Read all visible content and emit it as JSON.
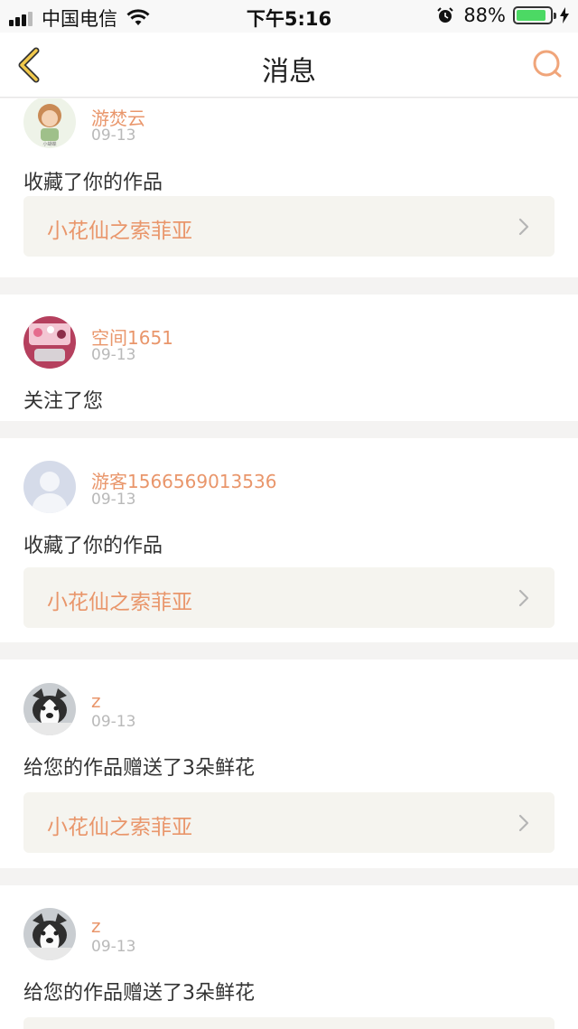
{
  "status": {
    "carrier": "中国电信",
    "time": "下午5:16",
    "battery": "88%",
    "battery_level": 0.88,
    "colors": {
      "battery_fill": "#4cd964"
    }
  },
  "nav": {
    "title": "消息",
    "back_icon": "chevron-left-icon",
    "search_icon": "search-icon",
    "accent": "#f2c94c"
  },
  "messages": [
    {
      "user": "游焚云",
      "date": "09-13",
      "action": "收藏了你的作品",
      "work": "小花仙之索菲亚"
    },
    {
      "user": "空间1651",
      "date": "09-13",
      "action": "关注了您"
    },
    {
      "user": "游客1566569013536",
      "date": "09-13",
      "action": "收藏了你的作品",
      "work": "小花仙之索菲亚"
    },
    {
      "user": "z",
      "date": "09-13",
      "action": "给您的作品赠送了3朵鲜花",
      "work": "小花仙之索菲亚"
    },
    {
      "user": "z",
      "date": "09-13",
      "action": "给您的作品赠送了3朵鲜花"
    }
  ]
}
